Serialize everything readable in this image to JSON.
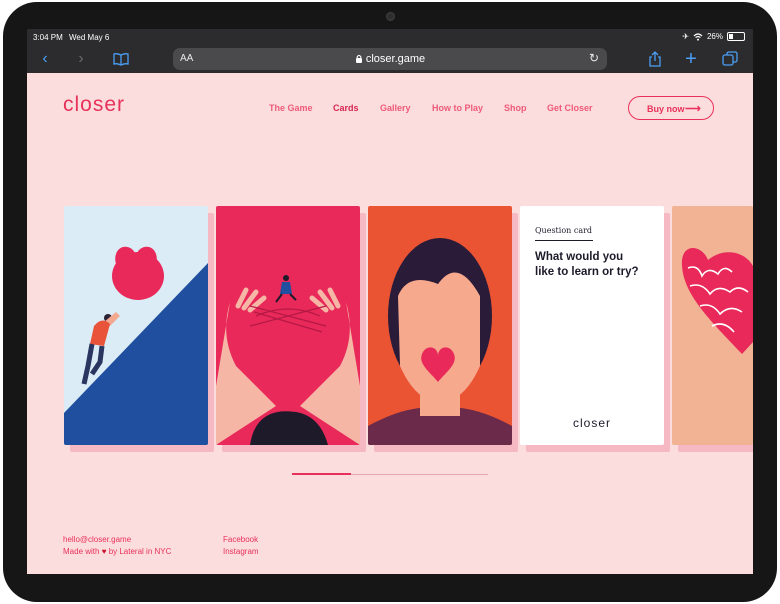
{
  "status_bar": {
    "time": "3:04 PM",
    "date": "Wed May 6",
    "battery": "26%"
  },
  "browser": {
    "text_size_label": "AA",
    "url": "closer.game"
  },
  "site": {
    "logo": "closer",
    "nav": [
      "The Game",
      "Cards",
      "Gallery",
      "How to Play",
      "Shop",
      "Get Closer"
    ],
    "active_nav": "Cards",
    "buy_label": "Buy now"
  },
  "question_card": {
    "label": "Question card",
    "text_line1": "What would you",
    "text_line2": "like to learn or try?",
    "logo": "closer"
  },
  "carousel": {
    "progress": 0.3
  },
  "footer": {
    "email": "hello@closer.game",
    "made_prefix": "Made with",
    "made_suffix": "by Lateral in NYC",
    "facebook": "Facebook",
    "instagram": "Instagram"
  },
  "colors": {
    "background": "#fcdddd",
    "accent": "#e8315a",
    "card_red": "#e8295a",
    "card_orange": "#ea5432",
    "card_blue": "#1f4f9e",
    "card_peach": "#f2b394"
  }
}
